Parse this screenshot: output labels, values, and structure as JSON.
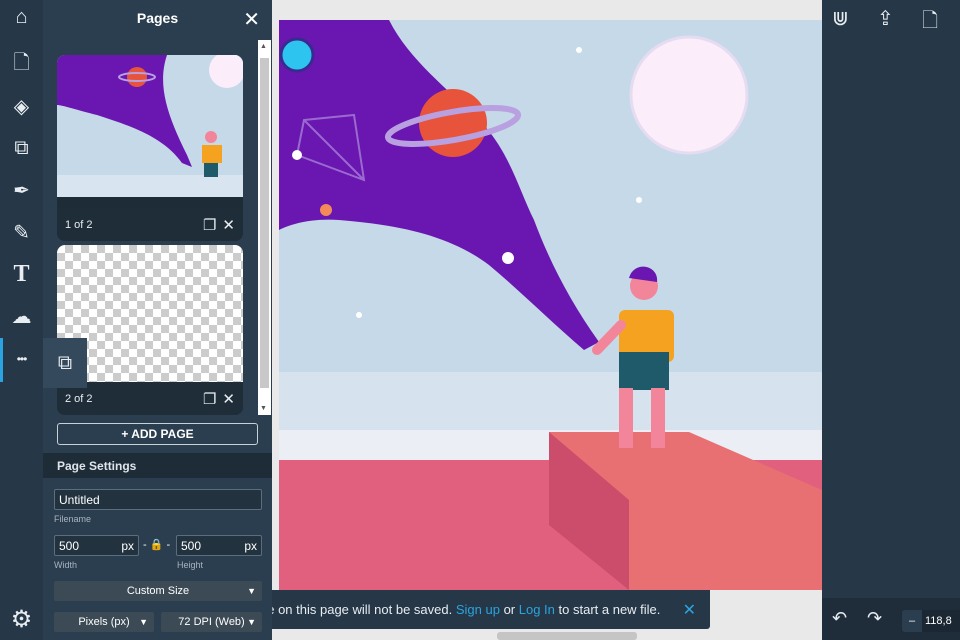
{
  "sidebar": {
    "items": [
      {
        "icon": "home-icon",
        "glyph": "⌂"
      },
      {
        "icon": "new-page-icon",
        "glyph": "🗋"
      },
      {
        "icon": "layers-icon",
        "glyph": "◈"
      },
      {
        "icon": "shapes-icon",
        "glyph": "⧉"
      },
      {
        "icon": "pen-tool-icon",
        "glyph": "✒"
      },
      {
        "icon": "pencil-icon",
        "glyph": "✎"
      },
      {
        "icon": "text-icon",
        "glyph": "T"
      },
      {
        "icon": "cloud-upload-icon",
        "glyph": "☁"
      },
      {
        "icon": "more-icon",
        "glyph": "•••"
      }
    ],
    "settings_glyph": "⚙",
    "flyout_glyph": "⧉"
  },
  "pages_panel": {
    "title": "Pages",
    "close": "✕",
    "pages": [
      {
        "label": "1 of 2"
      },
      {
        "label": "2 of 2"
      }
    ],
    "duplicate_glyph": "❐",
    "delete_glyph": "✕",
    "add_page": "+ ADD PAGE"
  },
  "page_settings": {
    "title": "Page Settings",
    "filename": "Untitled",
    "filename_label": "Filename",
    "width": "500",
    "width_unit": "px",
    "width_label": "Width",
    "height": "500",
    "height_unit": "px",
    "height_label": "Height",
    "lock_glyph": "- 🔒 -",
    "size_preset": "Custom Size",
    "units": "Pixels (px)",
    "dpi": "72 DPI (Web)"
  },
  "right_toolbar": {
    "icons": [
      "magnet-icon",
      "upload-icon",
      "export-file-icon"
    ]
  },
  "bottom": {
    "undo": "↶",
    "redo": "↷",
    "zoom_minus": "–",
    "zoom_value": "118,8"
  },
  "toast": {
    "text_before": "de on this page will not be saved. ",
    "signup": "Sign up",
    "or": " or ",
    "login": "Log In",
    "text_after": " to start a new file.",
    "close": "✕"
  },
  "colors": {
    "accent": "#2aa4e0",
    "panel": "#2b3e50",
    "sky": "#c5d9e8",
    "galaxy": "#6a16b0",
    "ground": "#e0607e"
  }
}
